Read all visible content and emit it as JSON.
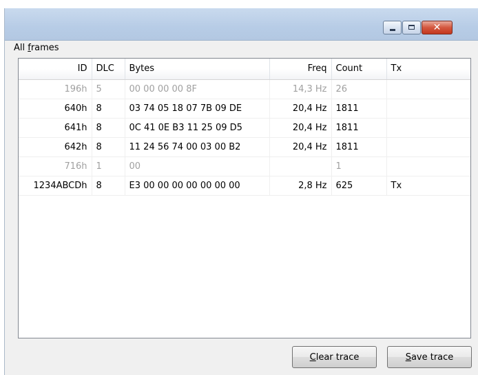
{
  "window": {
    "controls": {
      "minimize": "minimize-icon",
      "maximize": "maximize-icon",
      "close": "close-icon",
      "close_glyph": "✕"
    }
  },
  "group": {
    "label_prefix": "All ",
    "label_accel": "f",
    "label_rest": "rames"
  },
  "table": {
    "columns": [
      "ID",
      "DLC",
      "Bytes",
      "Freq",
      "Count",
      "Tx"
    ],
    "rows": [
      {
        "id": "196h",
        "dlc": "5",
        "bytes": "00 00 00 00  8F",
        "freq": "14,3 Hz",
        "count": "26",
        "tx": "",
        "dimmed": true
      },
      {
        "id": "640h",
        "dlc": "8",
        "bytes": "03 74 05 18  07 7B 09 DE",
        "freq": "20,4 Hz",
        "count": "1811",
        "tx": "",
        "dimmed": false
      },
      {
        "id": "641h",
        "dlc": "8",
        "bytes": "0C 41 0E B3  11 25 09 D5",
        "freq": "20,4 Hz",
        "count": "1811",
        "tx": "",
        "dimmed": false
      },
      {
        "id": "642h",
        "dlc": "8",
        "bytes": "11 24 56 74  00 03 00 B2",
        "freq": "20,4 Hz",
        "count": "1811",
        "tx": "",
        "dimmed": false
      },
      {
        "id": "716h",
        "dlc": "1",
        "bytes": "00",
        "freq": "",
        "count": "1",
        "tx": "",
        "dimmed": true
      },
      {
        "id": "1234ABCDh",
        "dlc": "8",
        "bytes": "E3 00 00 00  00 00 00 00",
        "freq": "2,8 Hz",
        "count": "625",
        "tx": "Tx",
        "dimmed": false
      }
    ]
  },
  "buttons": {
    "clear": {
      "accel": "C",
      "rest": "lear trace"
    },
    "save": {
      "accel": "S",
      "rest": "ave trace"
    }
  },
  "colors": {
    "dimmed_text": "#a0a0a0",
    "title_gradient_top": "#c9daee",
    "close_red": "#c3381f"
  }
}
